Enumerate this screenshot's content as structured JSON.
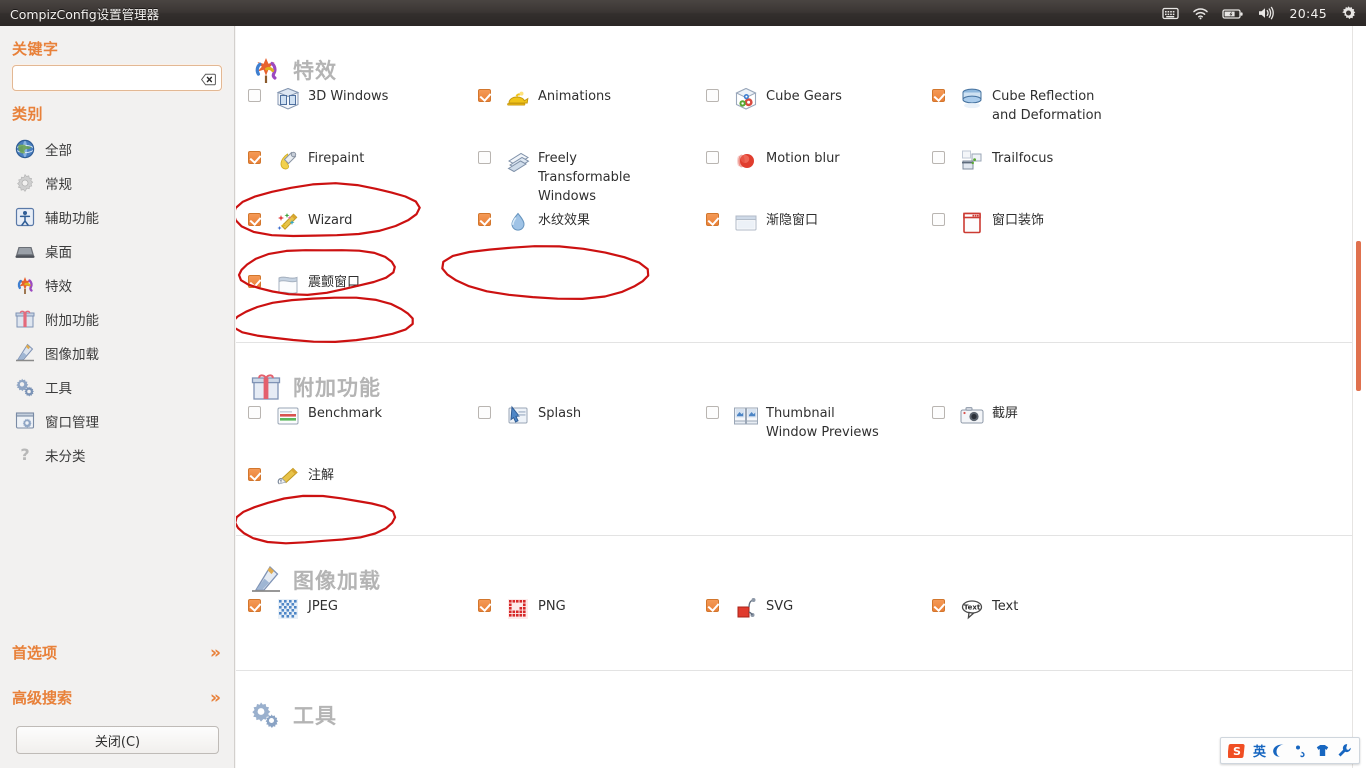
{
  "window": {
    "title": "CompizConfig设置管理器"
  },
  "tray": {
    "icons": [
      "keyboard-icon",
      "wifi-icon",
      "battery-icon",
      "volume-icon"
    ],
    "clock": "20:45",
    "gear": "gear-icon"
  },
  "sidebar": {
    "keyword_heading": "关键字",
    "search": {
      "value": "",
      "placeholder": "",
      "clear_icon": "clear-icon"
    },
    "category_heading": "类别",
    "items": [
      {
        "label": "全部",
        "icon": "globe-icon"
      },
      {
        "label": "常规",
        "icon": "gear-icon"
      },
      {
        "label": "辅助功能",
        "icon": "accessibility-icon"
      },
      {
        "label": "桌面",
        "icon": "desktop-icon"
      },
      {
        "label": "特效",
        "icon": "effects-icon"
      },
      {
        "label": "附加功能",
        "icon": "gift-icon"
      },
      {
        "label": "图像加载",
        "icon": "paint-icon"
      },
      {
        "label": "工具",
        "icon": "tools-icon"
      },
      {
        "label": "窗口管理",
        "icon": "window-manager-icon"
      },
      {
        "label": "未分类",
        "icon": "question-icon"
      }
    ],
    "preferences_label": "首选项",
    "advanced_search_label": "高级搜索",
    "chevron_icon": "chevron-right-icon",
    "close_button": "关闭(C)"
  },
  "colors": {
    "accent": "#e8813a",
    "checkbox_on": "#ea8038",
    "annotation": "#cc1111",
    "scrollbar": "#e0714e",
    "section_title": "#b4b4b4"
  },
  "main": {
    "sections": [
      {
        "title": "特效",
        "icon": "effects-icon",
        "plugins": [
          {
            "label": "3D Windows",
            "checked": false,
            "icon": "3d-windows-icon",
            "col": 0,
            "row": 0,
            "annotated": false
          },
          {
            "label": "Animations",
            "checked": true,
            "icon": "animations-icon",
            "col": 1,
            "row": 0,
            "annotated": false
          },
          {
            "label": "Cube Gears",
            "checked": false,
            "icon": "cube-gears-icon",
            "col": 2,
            "row": 0,
            "annotated": false
          },
          {
            "label": "Cube Reflection\nand Deformation",
            "checked": true,
            "icon": "cube-reflection-icon",
            "col": 3,
            "row": 0,
            "annotated": false
          },
          {
            "label": "Firepaint",
            "checked": true,
            "icon": "firepaint-icon",
            "col": 0,
            "row": 1,
            "annotated": true
          },
          {
            "label": "Freely\nTransformable\nWindows",
            "checked": false,
            "icon": "freely-transformable-icon",
            "col": 1,
            "row": 1,
            "annotated": false
          },
          {
            "label": "Motion blur",
            "checked": false,
            "icon": "motion-blur-icon",
            "col": 2,
            "row": 1,
            "annotated": false
          },
          {
            "label": "Trailfocus",
            "checked": false,
            "icon": "trailfocus-icon",
            "col": 3,
            "row": 1,
            "annotated": false
          },
          {
            "label": "Wizard",
            "checked": true,
            "icon": "wizard-icon",
            "col": 0,
            "row": 2,
            "annotated": true
          },
          {
            "label": "水纹效果",
            "checked": true,
            "icon": "water-effect-icon",
            "col": 1,
            "row": 2,
            "annotated": true
          },
          {
            "label": "渐隐窗口",
            "checked": true,
            "icon": "fade-windows-icon",
            "col": 2,
            "row": 2,
            "annotated": false
          },
          {
            "label": "窗口装饰",
            "checked": false,
            "icon": "window-decoration-icon",
            "col": 3,
            "row": 2,
            "annotated": false
          },
          {
            "label": "震颤窗口",
            "checked": true,
            "icon": "wobbly-windows-icon",
            "col": 0,
            "row": 3,
            "annotated": true
          }
        ]
      },
      {
        "title": "附加功能",
        "icon": "gift-icon",
        "plugins": [
          {
            "label": "Benchmark",
            "checked": false,
            "icon": "benchmark-icon",
            "col": 0,
            "row": 0,
            "annotated": false
          },
          {
            "label": "Splash",
            "checked": false,
            "icon": "splash-icon",
            "col": 1,
            "row": 0,
            "annotated": false
          },
          {
            "label": "Thumbnail\nWindow Previews",
            "checked": false,
            "icon": "thumbnail-icon",
            "col": 2,
            "row": 0,
            "annotated": false
          },
          {
            "label": "截屏",
            "checked": false,
            "icon": "screenshot-icon",
            "col": 3,
            "row": 0,
            "annotated": false
          },
          {
            "label": "注解",
            "checked": true,
            "icon": "annotate-icon",
            "col": 0,
            "row": 1,
            "annotated": true
          }
        ]
      },
      {
        "title": "图像加载",
        "icon": "paint-icon",
        "plugins": [
          {
            "label": "JPEG",
            "checked": true,
            "icon": "jpeg-icon",
            "col": 0,
            "row": 0,
            "annotated": false
          },
          {
            "label": "PNG",
            "checked": true,
            "icon": "png-icon",
            "col": 1,
            "row": 0,
            "annotated": false
          },
          {
            "label": "SVG",
            "checked": true,
            "icon": "svg-icon",
            "col": 2,
            "row": 0,
            "annotated": false
          },
          {
            "label": "Text",
            "checked": true,
            "icon": "text-icon",
            "col": 3,
            "row": 0,
            "annotated": false
          }
        ]
      },
      {
        "title": "工具",
        "icon": "tools-icon",
        "plugins": []
      }
    ]
  },
  "ime": {
    "logo": "sogou-logo-icon",
    "mode_label": "英",
    "buttons": [
      "moon-icon",
      "punctuation-icon",
      "skin-icon",
      "wrench-icon"
    ]
  }
}
